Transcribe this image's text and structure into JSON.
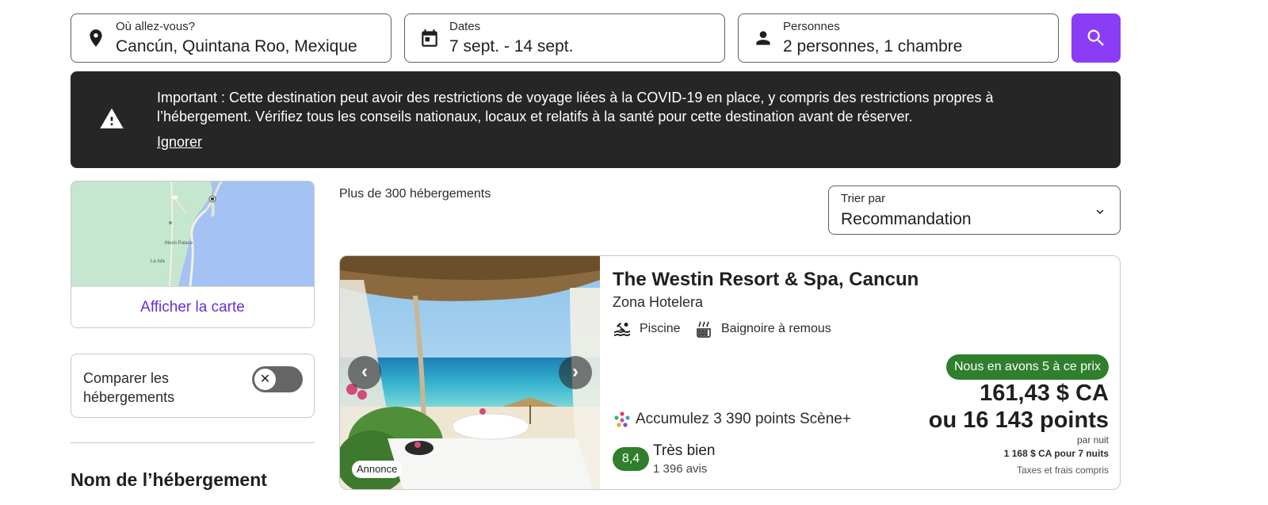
{
  "search": {
    "destination": {
      "label": "Où allez-vous?",
      "value": "Cancún, Quintana Roo, Mexique",
      "icon": "map-pin-icon"
    },
    "dates": {
      "label": "Dates",
      "value": "7 sept. - 14 sept.",
      "icon": "calendar-icon"
    },
    "travelers": {
      "label": "Personnes",
      "value": "2 personnes, 1 chambre",
      "icon": "person-icon"
    },
    "search_button_icon": "search-icon",
    "accent_color": "#8b3cf5"
  },
  "alert": {
    "message": "Important : Cette destination peut avoir des restrictions de voyage liées à la COVID-19 en place, y compris des restrictions propres à l’hébergement. Vérifiez tous les conseils nationaux, locaux et relatifs à la santé pour cette destination avant de réserver.",
    "dismiss_label": "Ignorer",
    "icon": "warning-icon"
  },
  "sidebar": {
    "map": {
      "show_map_label": "Afficher la carte",
      "place_labels": [
        "Moon Palace",
        "La Isla"
      ]
    },
    "compare": {
      "label": "Comparer les hébergements",
      "enabled": false
    },
    "filter_heading": "Nom de l’hébergement"
  },
  "results": {
    "count_text": "Plus de 300 hébergements",
    "sort": {
      "label": "Trier par",
      "value": "Recommandation"
    }
  },
  "hotel": {
    "name": "The Westin Resort & Spa, Cancun",
    "location": "Zona Hotelera",
    "amenities": [
      {
        "label": "Piscine",
        "icon": "pool-icon"
      },
      {
        "label": "Baignoire à remous",
        "icon": "hot-tub-icon"
      }
    ],
    "ad_label": "Annonce",
    "points_earn": "Accumulez 3 390 points Scène+",
    "rating": {
      "score": "8,4",
      "label": "Très bien",
      "reviews": "1 396 avis",
      "color": "#2f7f2c"
    },
    "deal_badge": "Nous en avons 5 à ce prix",
    "price": "161,43 $ CA",
    "points_price": "ou 16 143 points",
    "per_night": "par nuit",
    "total": "1 168 $ CA pour 7 nuits",
    "taxes": "Taxes et frais compris"
  }
}
